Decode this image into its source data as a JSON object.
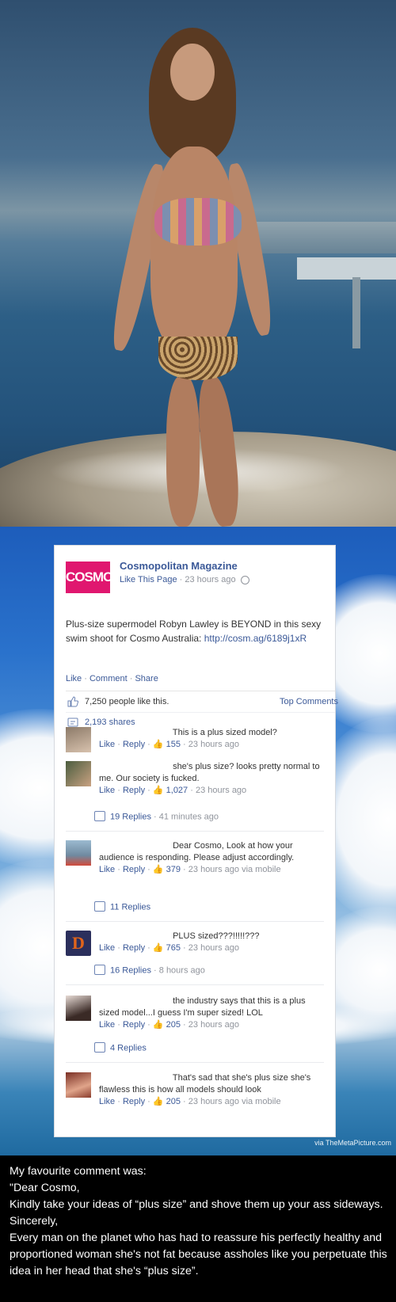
{
  "post": {
    "page_name": "Cosmopolitan Magazine",
    "logo_text": "COSMO",
    "like_page": "Like This Page",
    "time": "23 hours ago",
    "text_prefix": "Plus-size supermodel Robyn Lawley is BEYOND in this sexy swim shoot for Cosmo Australia: ",
    "url": "http://cosm.ag/6189j1xR",
    "actions": {
      "like": "Like",
      "comment": "Comment",
      "share": "Share"
    },
    "likes": "7,250 people like this.",
    "top_comments": "Top Comments",
    "shares": "2,193 shares"
  },
  "comments": [
    {
      "text": "This is a plus sized model?",
      "like": "Like",
      "reply": "Reply",
      "likes": "155",
      "time": "23 hours ago",
      "via": ""
    },
    {
      "text": "she's plus size? looks pretty normal to me. Our society is fucked.",
      "like": "Like",
      "reply": "Reply",
      "likes": "1,027",
      "time": "23 hours ago",
      "via": "",
      "replies": "19 Replies",
      "replies_time": "41 minutes ago"
    },
    {
      "text": "Dear Cosmo, Look at how your audience is responding. Please adjust accordingly.",
      "like": "Like",
      "reply": "Reply",
      "likes": "379",
      "time": "23 hours ago",
      "via": "via mobile",
      "replies": "11 Replies",
      "replies_time": ""
    },
    {
      "text": "PLUS sized???!!!!!???",
      "like": "Like",
      "reply": "Reply",
      "likes": "765",
      "time": "23 hours ago",
      "via": "",
      "replies": "16 Replies",
      "replies_time": "8 hours ago"
    },
    {
      "text": "the industry says that this is a plus sized model...I guess I'm super sized! LOL",
      "like": "Like",
      "reply": "Reply",
      "likes": "205",
      "time": "23 hours ago",
      "via": "",
      "replies": "4 Replies",
      "replies_time": ""
    },
    {
      "text": "That's sad that she's plus size she's flawless this is how all models should look",
      "like": "Like",
      "reply": "Reply",
      "likes": "205",
      "time": "23 hours ago",
      "via": "via mobile"
    }
  ],
  "watermark": "via TheMetaPicture.com",
  "caption": [
    "My favourite comment was:",
    "\"Dear Cosmo,",
    "Kindly take your ideas of “plus size” and shove them up your ass sideways.",
    "Sincerely,",
    "Every man on the planet who has had to reassure his perfectly healthy and proportioned woman she's not fat because assholes like you perpetuate this idea in her head that she's “plus size”."
  ],
  "colors": {
    "fb_blue": "#3b5998",
    "cosmo_pink": "#e0176f"
  }
}
